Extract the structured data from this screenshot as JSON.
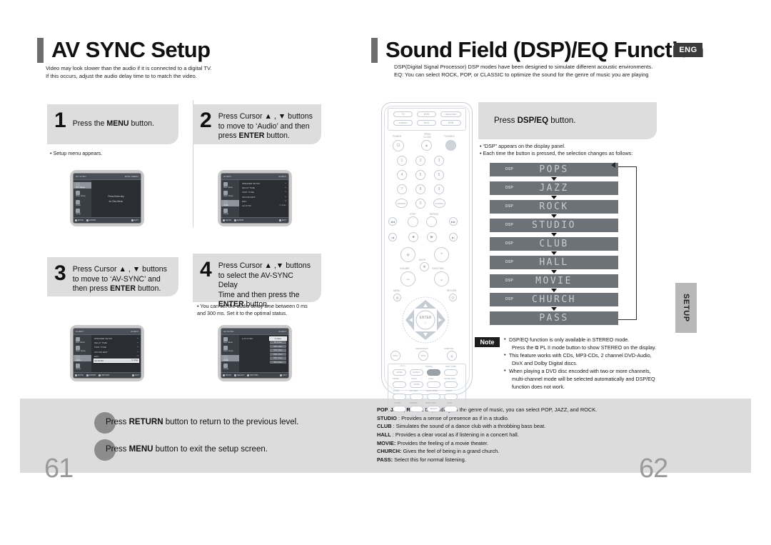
{
  "left": {
    "title": "AV SYNC Setup",
    "subtitle_line1": "Video may look slower than the audio if it is connected to a digital TV.",
    "subtitle_line2": "If this occurs, adjust the audio delay time to to match the video.",
    "page_number": "61",
    "steps": [
      {
        "num": "1",
        "text_html": "Press the <b>MENU</b> button.",
        "note": "• Setup menu appears."
      },
      {
        "num": "2",
        "text_html": "Press Cursor ▲ , ▼ buttons<br>to move to ‘Audio’ and then<br>press <b>ENTER</b> button.",
        "note": ""
      },
      {
        "num": "3",
        "text_html": "Press Cursor ▲ , ▼ buttons<br>to move to ‘AV-SYNC’ and<br>then press <b>ENTER</b> button.",
        "note": ""
      },
      {
        "num": "4",
        "text_html": "Press Cursor ▲ ,▼  buttons<br>to select the AV-SYNC Delay<br>Time  and then press the<br><b>ENTER</b> button.",
        "note": "• You can set the audio delay time between 0 ms\n  and 300 ms. Set it to the optimal status."
      }
    ],
    "footer": [
      "Press RETURN button to return to the previous level.",
      "Press MENU button to exit the setup screen."
    ],
    "footer_bold": [
      "RETURN",
      "MENU"
    ],
    "osd": {
      "screen1": {
        "header_left": "AV SYNC",
        "header_right": "DISC MENU",
        "sidebar": [
          "Disc Setup",
          "Filter Setup",
          "Audio",
          "Setup"
        ],
        "center": [
          "Press Enter key",
          "for Disc Menu"
        ],
        "footer": [
          "MOVE",
          "ENTER",
          "EXIT"
        ]
      },
      "screen2": {
        "header_left": "AUDIO",
        "header_right": "AUDIO",
        "sidebar": [
          "Disc Setup",
          "Filter Setup",
          "Audio",
          "Setup"
        ],
        "rows": [
          {
            "label": "SPEAKER SETUP",
            "value": "▸"
          },
          {
            "label": "DELAY TIME",
            "value": "▸"
          },
          {
            "label": "TEST TONE",
            "value": "▸"
          },
          {
            "label": "SOUND EDIT",
            "value": "▸"
          },
          {
            "label": "DRC",
            "value": ": 3"
          },
          {
            "label": "AV-SYNC",
            "value": ": 0 mSec"
          }
        ],
        "footer": [
          "MOVE",
          "ENTER",
          "EXIT"
        ]
      },
      "screen3": {
        "header_left": "AUDIO",
        "header_right": "AUDIO",
        "sidebar": [
          "Disc Setup",
          "Filter Setup",
          "Audio",
          "Setup"
        ],
        "rows": [
          {
            "label": "SPEAKER SETUP",
            "value": "▸"
          },
          {
            "label": "DELAY TIME",
            "value": "▸"
          },
          {
            "label": "TEST TONE",
            "value": "▸"
          },
          {
            "label": "SOUND EDIT",
            "value": "▸"
          },
          {
            "label": "DRC",
            "value": ": 3"
          },
          {
            "label": "AV-SYNC",
            "value": ": 0 mSec"
          }
        ],
        "selected_row": 5,
        "footer": [
          "MOVE",
          "ENTER",
          "RETURN",
          "EXIT"
        ]
      },
      "screen4": {
        "header_left": "AV-SYNC",
        "header_right": "AUDIO",
        "sidebar": [
          "Disc Setup",
          "Filter Setup",
          "Audio",
          "Setup"
        ],
        "label": "▸ AV-SYNC",
        "values": [
          "0 mSec",
          "50 mSec",
          "100 mSec",
          "150 mSec",
          "200 mSec",
          "250 mSec",
          "300 mSec"
        ],
        "selected_value": 0,
        "footer": [
          "MOVE",
          "SELECT",
          "RETURN",
          "EXIT"
        ]
      }
    }
  },
  "right": {
    "title": "Sound Field (DSP)/EQ Function",
    "lang_badge": "ENG",
    "subtitle_line1": "DSP(Digital Signal Processor) DSP modes have been designed to simulate different acoustic environments.",
    "subtitle_line2": "EQ: You can select ROCK, POP, or CLASSIC to optimize the sound for the genre of music you are playing",
    "page_number": "62",
    "step": {
      "text_html": "Press <b>DSP/EQ</b> button."
    },
    "bullets": [
      "• “DSP” appears on the display panel.",
      "• Each time the button is pressed, the selection changes as follows:"
    ],
    "dsp_list": [
      {
        "tag": "DSP",
        "name": "POPS"
      },
      {
        "tag": "DSP",
        "name": "JAZZ"
      },
      {
        "tag": "DSP",
        "name": "ROCK"
      },
      {
        "tag": "DSP",
        "name": "STUDIO"
      },
      {
        "tag": "DSP",
        "name": "CLUB"
      },
      {
        "tag": "DSP",
        "name": "HALL"
      },
      {
        "tag": "DSP",
        "name": "MOVIE"
      },
      {
        "tag": "DSP",
        "name": "CHURCH"
      },
      {
        "tag": "",
        "name": "PASS"
      }
    ],
    "note_badge": "Note",
    "notes": [
      "DSP/EQ function is only available in STEREO mode.<br>&nbsp;&nbsp;Press the ⧉ PL II mode button to show STEREO on the display.",
      "This feature works with CDs, MP3-CDs, 2 channel DVD-Audio,<br>&nbsp;&nbsp;DivX and Dolby Digital discs.",
      "When playing a DVD disc encoded with two or more channels,<br>&nbsp;&nbsp;multi-channel mode will be selected automatically and DSP/EQ<br>&nbsp;&nbsp;function does not work."
    ],
    "descriptions": [
      {
        "term": "POP, JAZZ, ROCK:",
        "text": " Depending on the genre of music, you can select POP, JAZZ, and ROCK."
      },
      {
        "term": "STUDIO",
        "text": " : Provides a sense of presence as if in a studio."
      },
      {
        "term": "CLUB",
        "text": " : Simulates the sound of a dance club with a throbbing bass beat."
      },
      {
        "term": "HALL",
        "text": " : Provides a clear vocal as if listening in a concert hall."
      },
      {
        "term": "MOVIE:",
        "text": " Provides the feeling of a movie theater."
      },
      {
        "term": "CHURCH:",
        "text": " Gives the feel of being in a grand church."
      },
      {
        "term": "PASS:",
        "text": " Select this for normal listening."
      }
    ],
    "setup_tab": "SETUP",
    "remote": {
      "source_buttons": [
        "TV",
        "DVD",
        "RECEIVER",
        "STEREO",
        "AUX",
        "USB"
      ],
      "top_labels": [
        "POWER",
        "OPEN/<br>CLOSE",
        "TV/VIDEO"
      ],
      "numbers": [
        "1",
        "2",
        "3",
        "4",
        "5",
        "6",
        "7",
        "8",
        "9",
        "0"
      ],
      "extra_buttons": [
        "REMAIN",
        "CANCEL"
      ],
      "transport_labels": [
        "STEP",
        "REPEAT"
      ],
      "volume_labels": [
        "VOLUME",
        "MUTE",
        "FUNCTION"
      ],
      "nav_labels": [
        "MENU",
        "RETURN",
        "ENTER"
      ],
      "mid_labels": [
        "INFO",
        "SD/DVD/DIVX",
        "SUBTITLE",
        "DIMMER"
      ],
      "grid_buttons": [
        "MODE",
        "EFFECT",
        "DSP/EQ",
        "TEST TONE",
        "P.BASS",
        "SLOW",
        "LOGO",
        "SOUND EDIT",
        "ZOOM",
        "EZ VIEW",
        "SL/SR MODE",
        "ASSIST",
        "S.STEP",
        "DIMMER",
        "HDMI AUDIO",
        "SCAN"
      ],
      "grid_highlight": "DSP/EQ",
      "bottom_button": "SELECT"
    }
  }
}
